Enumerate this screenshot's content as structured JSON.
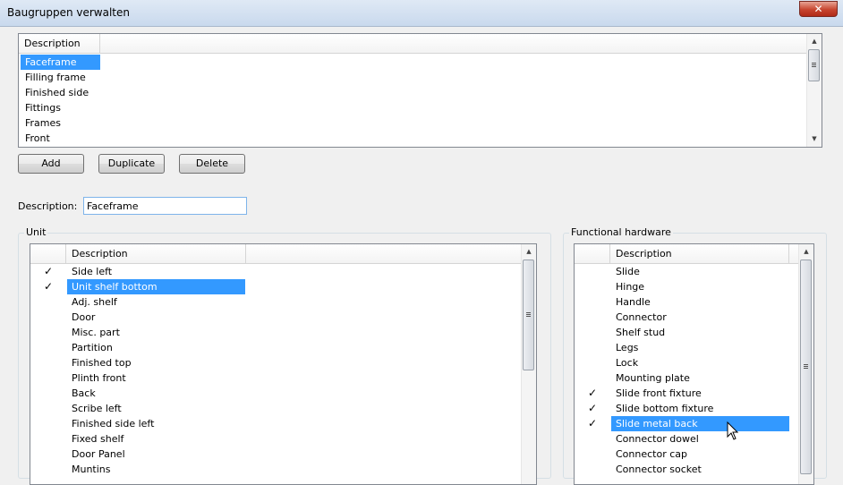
{
  "window": {
    "title": "Baugruppen verwalten",
    "close_glyph": "✕"
  },
  "top_list": {
    "column_header": "Description",
    "items": [
      "Faceframe",
      "Filling frame",
      "Finished side",
      "Fittings",
      "Frames",
      "Front"
    ],
    "selected_index": 0
  },
  "buttons": {
    "add": "Add",
    "duplicate": "Duplicate",
    "delete": "Delete"
  },
  "description_field": {
    "label": "Description:",
    "value": "Faceframe"
  },
  "unit": {
    "group_label": "Unit",
    "column_header": "Description",
    "check_glyph": "✓",
    "items": [
      {
        "label": "Side left",
        "checked": true
      },
      {
        "label": "Unit shelf bottom",
        "checked": true,
        "selected": true
      },
      {
        "label": "Adj. shelf",
        "checked": false
      },
      {
        "label": "Door",
        "checked": false
      },
      {
        "label": "Misc. part",
        "checked": false
      },
      {
        "label": "Partition",
        "checked": false
      },
      {
        "label": "Finished top",
        "checked": false
      },
      {
        "label": "Plinth front",
        "checked": false
      },
      {
        "label": "Back",
        "checked": false
      },
      {
        "label": "Scribe left",
        "checked": false
      },
      {
        "label": "Finished side left",
        "checked": false
      },
      {
        "label": "Fixed shelf",
        "checked": false
      },
      {
        "label": "Door Panel",
        "checked": false
      },
      {
        "label": "Muntins",
        "checked": false
      }
    ]
  },
  "hardware": {
    "group_label": "Functional hardware",
    "column_header": "Description",
    "check_glyph": "✓",
    "items": [
      {
        "label": "Slide",
        "checked": false
      },
      {
        "label": "Hinge",
        "checked": false
      },
      {
        "label": "Handle",
        "checked": false
      },
      {
        "label": "Connector",
        "checked": false
      },
      {
        "label": "Shelf stud",
        "checked": false
      },
      {
        "label": "Legs",
        "checked": false
      },
      {
        "label": "Lock",
        "checked": false
      },
      {
        "label": "Mounting plate",
        "checked": false
      },
      {
        "label": "Slide front fixture",
        "checked": true
      },
      {
        "label": "Slide bottom fixture",
        "checked": true
      },
      {
        "label": "Slide metal back",
        "checked": true,
        "selected": true
      },
      {
        "label": "Connector dowel",
        "checked": false
      },
      {
        "label": "Connector cap",
        "checked": false
      },
      {
        "label": "Connector socket",
        "checked": false
      }
    ]
  },
  "scrollbar": {
    "up_glyph": "▲",
    "down_glyph": "▼"
  },
  "colors": {
    "selection": "#3399ff",
    "close_button": "#c7452f"
  }
}
